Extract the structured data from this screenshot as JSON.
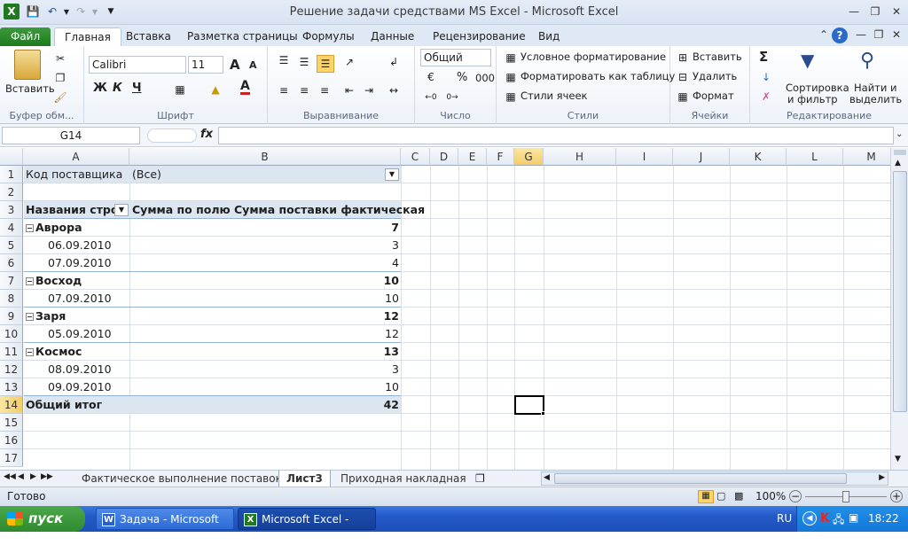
{
  "window": {
    "title": "Решение задачи средствами MS Excel  -  Microsoft Excel"
  },
  "ribbon_tabs": [
    "Файл",
    "Главная",
    "Вставка",
    "Разметка страницы",
    "Формулы",
    "Данные",
    "Рецензирование",
    "Вид"
  ],
  "ribbon": {
    "clipboard": {
      "paste": "Вставить",
      "label": "Буфер обм..."
    },
    "font": {
      "name": "Calibri",
      "size": "11",
      "bold": "Ж",
      "italic": "К",
      "underline": "Ч",
      "grow": "A",
      "shrink": "A",
      "color_letter": "A",
      "label": "Шрифт"
    },
    "alignment": {
      "label": "Выравнивание"
    },
    "number": {
      "format": "Общий",
      "percent": "%",
      "thousands": "000",
      "label": "Число"
    },
    "styles": {
      "conditional": "Условное форматирование",
      "as_table": "Форматировать как таблицу",
      "cell_styles": "Стили ячеек",
      "label": "Стили"
    },
    "cells": {
      "insert": "Вставить",
      "delete": "Удалить",
      "format": "Формат",
      "label": "Ячейки"
    },
    "editing": {
      "sigma": "Σ",
      "sort1": "Сортировка",
      "sort2": "и фильтр",
      "find1": "Найти и",
      "find2": "выделить",
      "label": "Редактирование"
    }
  },
  "formula_bar": {
    "name_box": "G14",
    "fx": "fx",
    "formula": ""
  },
  "columns": [
    "A",
    "B",
    "C",
    "D",
    "E",
    "F",
    "G",
    "H",
    "I",
    "J",
    "K",
    "L",
    "M"
  ],
  "rows": [
    "1",
    "2",
    "3",
    "4",
    "5",
    "6",
    "7",
    "8",
    "9",
    "10",
    "11",
    "12",
    "13",
    "14",
    "15",
    "16",
    "17"
  ],
  "pivot": {
    "filter_label": "Код поставщика",
    "filter_value": "(Все)",
    "row_header": "Названия строк",
    "value_header": "Сумма по полю Сумма поставки фактическая",
    "rows": [
      {
        "label": "Аврора",
        "value": "7",
        "level": 0
      },
      {
        "label": "06.09.2010",
        "value": "3",
        "level": 1
      },
      {
        "label": "07.09.2010",
        "value": "4",
        "level": 1
      },
      {
        "label": "Восход",
        "value": "10",
        "level": 0
      },
      {
        "label": "07.09.2010",
        "value": "10",
        "level": 1
      },
      {
        "label": "Заря",
        "value": "12",
        "level": 0
      },
      {
        "label": "05.09.2010",
        "value": "12",
        "level": 1
      },
      {
        "label": "Космос",
        "value": "13",
        "level": 0
      },
      {
        "label": "08.09.2010",
        "value": "3",
        "level": 1
      },
      {
        "label": "09.09.2010",
        "value": "10",
        "level": 1
      }
    ],
    "total_label": "Общий итог",
    "total_value": "42"
  },
  "sheets": [
    "Фактическое выполнение поставок",
    "Лист3",
    "Приходная накладная"
  ],
  "active_sheet": "Лист3",
  "status": {
    "ready": "Готово",
    "zoom": "100%"
  },
  "taskbar": {
    "start": "пуск",
    "tasks": [
      "Задача - Microsoft W...",
      "Microsoft Excel - Реш..."
    ],
    "lang": "RU",
    "clock": "18:22"
  }
}
